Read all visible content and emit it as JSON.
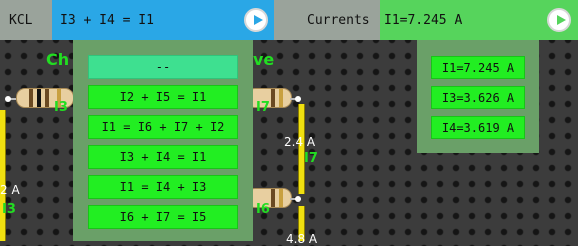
{
  "kcl_bar": {
    "label": "KCL",
    "equation": "I3 + I4 = I1",
    "play_icon": "play-icon"
  },
  "currents_bar": {
    "label": "Currents",
    "value": "I1=7.245 A",
    "play_icon": "play-icon"
  },
  "circuit": {
    "title_left": "Ch",
    "title_right": "ve",
    "labels": [
      "I3",
      "I7",
      "I7",
      "I6",
      "I3"
    ],
    "values": [
      "2.4 A",
      "2 A",
      "4.8 A"
    ]
  },
  "equation_dropdown": {
    "placeholder": "--",
    "options": [
      "I2 + I5 = I1",
      "I1 = I6 + I7 + I2",
      "I3 + I4 = I1",
      "I1 = I4 + I3",
      "I6 + I7 = I5"
    ]
  },
  "currents_list": {
    "items": [
      "I1=7.245 A",
      "I3=3.626 A",
      "I4=3.619 A"
    ]
  },
  "colors": {
    "kcl_accent": "#2aa7e6",
    "currents_accent": "#56d45c",
    "option_green": "#22ee22",
    "label_green": "#22dd22",
    "wire_yellow": "#f0e010"
  }
}
